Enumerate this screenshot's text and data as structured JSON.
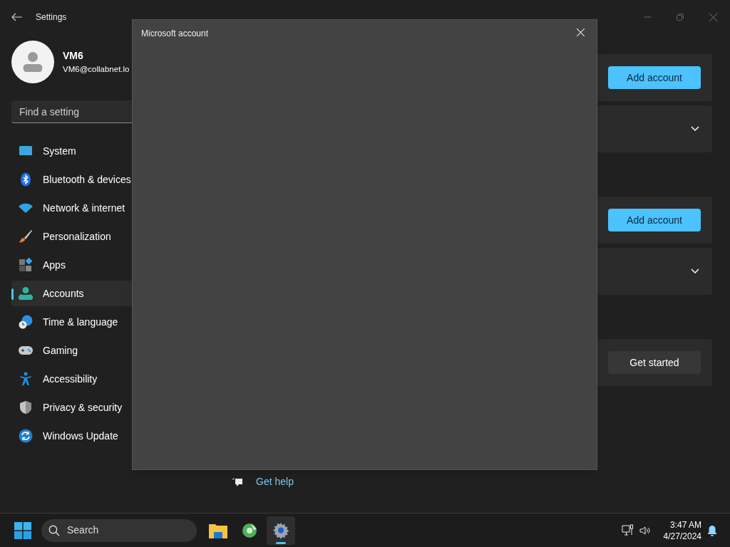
{
  "window": {
    "title": "Settings"
  },
  "user": {
    "name": "VM6",
    "email": "VM6@collabnet.lo"
  },
  "search": {
    "placeholder": "Find a setting"
  },
  "nav": [
    {
      "label": "System",
      "kind": "system",
      "selected": false
    },
    {
      "label": "Bluetooth & devices",
      "kind": "bluetooth",
      "selected": false
    },
    {
      "label": "Network & internet",
      "kind": "wifi",
      "selected": false
    },
    {
      "label": "Personalization",
      "kind": "brush",
      "selected": false
    },
    {
      "label": "Apps",
      "kind": "apps",
      "selected": false
    },
    {
      "label": "Accounts",
      "kind": "person",
      "selected": true
    },
    {
      "label": "Time & language",
      "kind": "globe",
      "selected": false
    },
    {
      "label": "Gaming",
      "kind": "gamepad",
      "selected": false
    },
    {
      "label": "Accessibility",
      "kind": "accessibility",
      "selected": false
    },
    {
      "label": "Privacy & security",
      "kind": "shield",
      "selected": false
    },
    {
      "label": "Windows Update",
      "kind": "update",
      "selected": false
    }
  ],
  "sections": [
    {
      "cards": [
        {
          "kind": "button",
          "label": "Add account",
          "accent": true
        },
        {
          "kind": "expander"
        }
      ]
    },
    {
      "cards": [
        {
          "kind": "button",
          "label": "Add account",
          "accent": true
        },
        {
          "kind": "expander"
        }
      ]
    },
    {
      "cards": [
        {
          "kind": "button",
          "label": "Get started",
          "accent": false
        }
      ]
    }
  ],
  "help_link": "Get help",
  "dialog": {
    "title": "Microsoft account"
  },
  "taskbar": {
    "search_placeholder": "Search",
    "apps": [
      {
        "kind": "folder",
        "selected": false
      },
      {
        "kind": "disc",
        "selected": false
      },
      {
        "kind": "settings",
        "selected": true
      }
    ],
    "time": "3:47 AM",
    "date": "4/27/2024"
  }
}
